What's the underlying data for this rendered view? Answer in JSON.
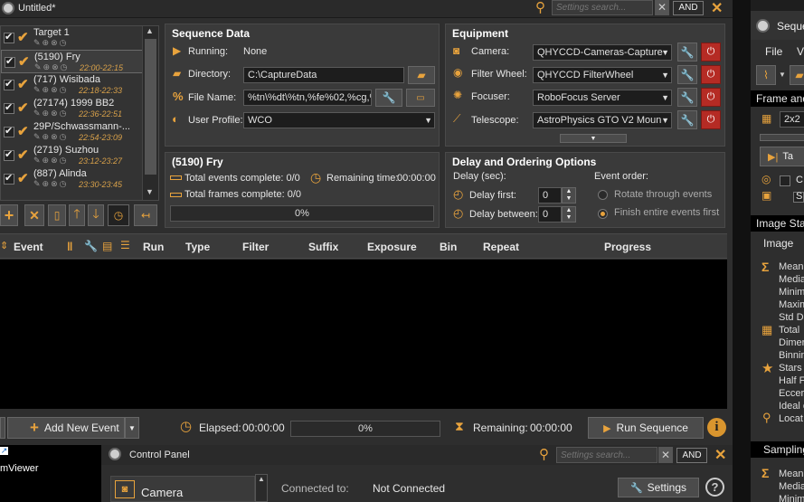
{
  "window": {
    "title": "Untitled*"
  },
  "search": {
    "placeholder": "Settings search...",
    "and_label": "AND"
  },
  "targets": [
    {
      "name": "Target 1",
      "time": "",
      "checked": true
    },
    {
      "name": "(5190) Fry",
      "time": "22:00-22:15",
      "checked": true
    },
    {
      "name": "(717) Wisibada",
      "time": "22:18-22:33",
      "checked": true
    },
    {
      "name": "(27174) 1999 BB2",
      "time": "22:36-22:51",
      "checked": true
    },
    {
      "name": "29P/Schwassmann-...",
      "time": "22:54-23:09",
      "checked": true
    },
    {
      "name": "(2719) Suzhou",
      "time": "23:12-23:27",
      "checked": true
    },
    {
      "name": "(887) Alinda",
      "time": "23:30-23:45",
      "checked": true
    }
  ],
  "sequence": {
    "title": "Sequence Data",
    "running_label": "Running:",
    "running_value": "None",
    "directory_label": "Directory:",
    "directory_value": "C:\\CaptureData",
    "filename_label": "File Name:",
    "filename_value": "%tn\\%dt\\%tn,%fe%02,%cg,%",
    "profile_label": "User Profile:",
    "profile_value": "WCO"
  },
  "equipment": {
    "title": "Equipment",
    "camera_label": "Camera:",
    "camera_value": "QHYCCD-Cameras-Capture",
    "filterwheel_label": "Filter Wheel:",
    "filterwheel_value": "QHYCCD FilterWheel",
    "focuser_label": "Focuser:",
    "focuser_value": "RoboFocus Server",
    "telescope_label": "Telescope:",
    "telescope_value": "AstroPhysics GTO V2 Moun"
  },
  "target_status": {
    "title": "(5190) Fry",
    "events_label": "Total events complete: 0/0",
    "remaining_label": "Remaining time:",
    "remaining_value": "00:00:00",
    "frames_label": "Total frames complete: 0/0",
    "progress": "0%"
  },
  "delay": {
    "title": "Delay and Ordering Options",
    "delay_sec_label": "Delay (sec):",
    "delay_first_label": "Delay first:",
    "delay_first_value": "0",
    "delay_between_label": "Delay between:",
    "delay_between_value": "0",
    "event_order_label": "Event order:",
    "rotate_label": "Rotate through events",
    "finish_label": "Finish entire events first",
    "selected": "finish"
  },
  "events_table": {
    "columns": {
      "event": "Event",
      "run": "Run",
      "type": "Type",
      "filter": "Filter",
      "suffix": "Suffix",
      "exposure": "Exposure",
      "bin": "Bin",
      "repeat": "Repeat",
      "progress": "Progress"
    }
  },
  "footer": {
    "add_event_label": "Add New Event",
    "elapsed_label": "Elapsed:",
    "elapsed_value": "00:00:00",
    "progress": "0%",
    "remaining_label": "Remaining:",
    "remaining_value": "00:00:00",
    "run_sequence_label": "Run Sequence"
  },
  "control_panel": {
    "title": "Control Panel",
    "camera_label": "Camera",
    "connected_label": "Connected to:",
    "connected_value": "Not Connected",
    "settings_label": "Settings"
  },
  "taskbar": {
    "viewer_label": "mViewer"
  },
  "right_window": {
    "title": "Seque",
    "menu": [
      "File",
      "V"
    ],
    "frame_label": "Frame and",
    "bin_value": "2x2",
    "image_stats_title": "Image Sta",
    "image_label": "Image",
    "stats": [
      "Mean",
      "Media",
      "Minim",
      "Maxim",
      "Std D",
      "Total",
      "Dimer",
      "Binnin",
      "Stars",
      "Half F",
      "Eccer",
      "Ideal c",
      "Locat"
    ],
    "sampling_label": "Sampling",
    "sampling_stats": [
      "Mean",
      "Media",
      "Minim"
    ],
    "checkbox_labels": [
      "C",
      "S"
    ],
    "take_label": "Ta"
  },
  "colors": {
    "accent": "#e8a33d",
    "danger": "#b52b24",
    "panel": "#3a3a3a",
    "background": "#1e1e1e"
  }
}
